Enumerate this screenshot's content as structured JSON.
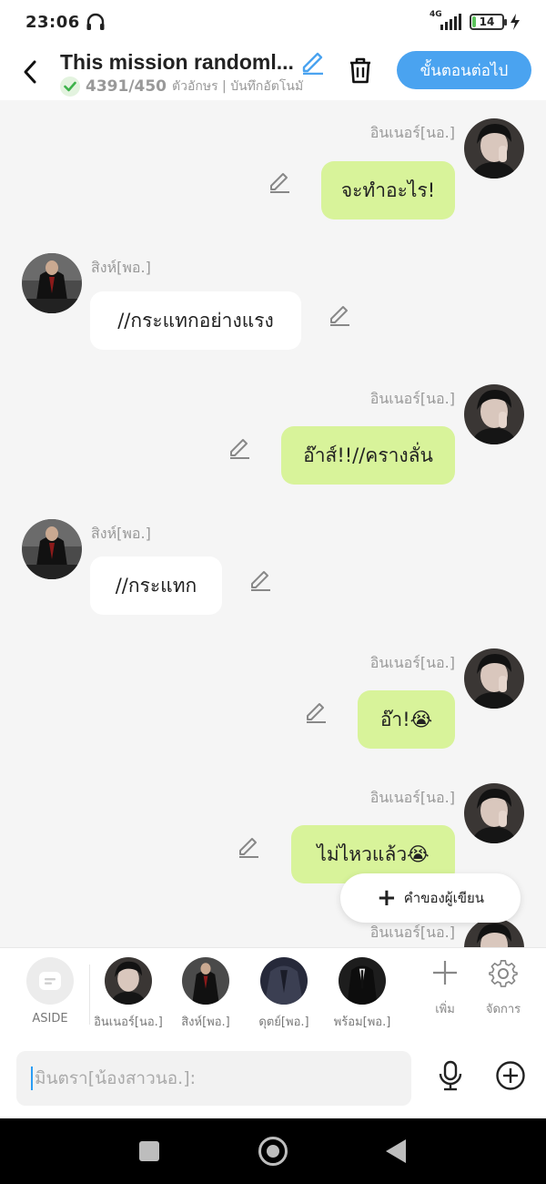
{
  "status_bar": {
    "time": "23:06",
    "network": "4G",
    "battery_level": "14",
    "battery_fraction": 0.14
  },
  "header": {
    "title": "This mission randoml...",
    "char_count": "4391/450",
    "char_unit": "ตัวอักษร | บันทึกอัตโนมั",
    "next_button": "ขั้นตอนต่อไป"
  },
  "messages": [
    {
      "side": "right",
      "speaker": "อินเนอร์[นอ.]",
      "text": "จะทำอะไร!",
      "avatar": "avatar-inner"
    },
    {
      "side": "left",
      "speaker": "สิงห์[พอ.]",
      "text": "//กระแทกอย่างแรง",
      "avatar": "avatar-singh"
    },
    {
      "side": "right",
      "speaker": "อินเนอร์[นอ.]",
      "text": "อ๊าส์!!//ครางลั่น",
      "avatar": "avatar-inner"
    },
    {
      "side": "left",
      "speaker": "สิงห์[พอ.]",
      "text": "//กระแทก",
      "avatar": "avatar-singh"
    },
    {
      "side": "right",
      "speaker": "อินเนอร์[นอ.]",
      "text": "อ๊า!😭",
      "avatar": "avatar-inner"
    },
    {
      "side": "right",
      "speaker": "อินเนอร์[นอ.]",
      "text": "ไม่ไหวแล้ว😭",
      "avatar": "avatar-inner"
    },
    {
      "side": "right",
      "speaker": "อินเนอร์[นอ.]",
      "text": "",
      "avatar": "avatar-inner"
    }
  ],
  "author_note_button": "คำของผู้เขียน",
  "characters": [
    {
      "label": "ASIDE",
      "icon": "aside-icon"
    },
    {
      "label": "อินเนอร์[นอ.]",
      "icon": "avatar-inner"
    },
    {
      "label": "สิงห์[พอ.]",
      "icon": "avatar-singh"
    },
    {
      "label": "ดุตย์[พอ.]",
      "icon": "avatar-dut"
    },
    {
      "label": "พร้อม[พอ.]",
      "icon": "avatar-prom"
    }
  ],
  "tools": {
    "add_label": "เพิ่ม",
    "manage_label": "จัดการ"
  },
  "input": {
    "placeholder": "มินตรา[น้องสาวนอ.]:"
  },
  "colors": {
    "accent": "#4aa3f0",
    "bubble_right": "#d8f39a",
    "bubble_left": "#ffffff",
    "background": "#f5f5f5"
  }
}
